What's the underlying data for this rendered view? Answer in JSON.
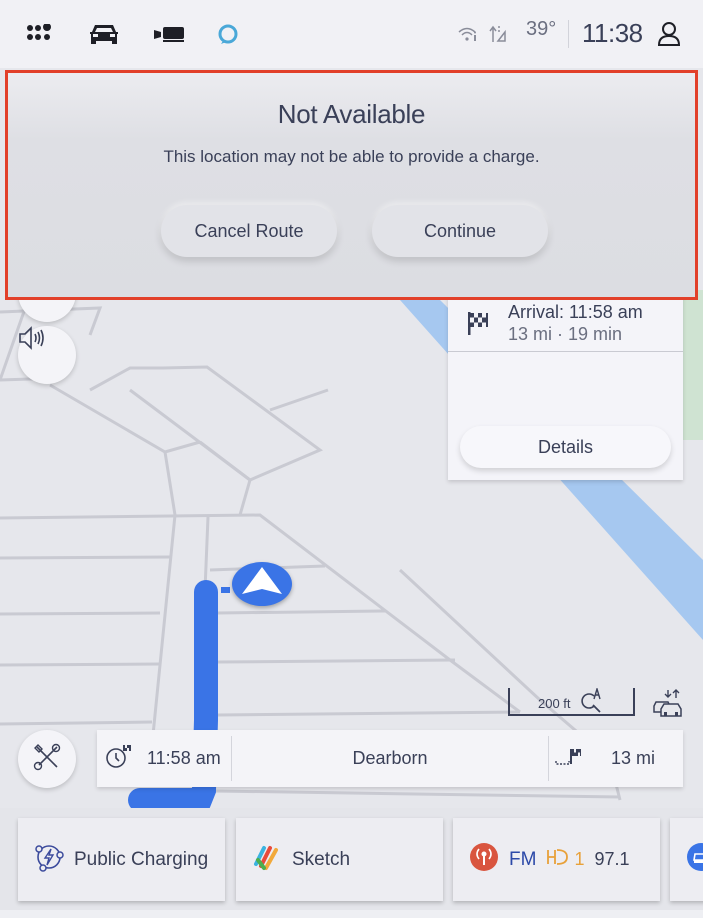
{
  "status_bar": {
    "icons": [
      "apps-grid-icon",
      "vehicle-icon",
      "camera-icon",
      "alexa-icon"
    ],
    "wifi_icon": "wifi-icon",
    "data_icon": "data-transfer-icon",
    "temperature": "39°",
    "time": "11:38",
    "profile_icon": "profile-icon"
  },
  "dialog": {
    "title": "Not Available",
    "message": "This location may not be able to provide a charge.",
    "buttons": {
      "cancel": "Cancel Route",
      "continue": "Continue"
    },
    "highlight_color": "#e2402a"
  },
  "map": {
    "controls": {
      "audio_icon": "speaker-icon",
      "tools_icon": "tools-icon"
    },
    "arrival_card": {
      "arrival": "Arrival: 11:58 am",
      "summary": "13 mi · 19 min",
      "details_label": "Details"
    },
    "scale_label": "200 ft",
    "route_color": "#3a74e6",
    "water_color": "#a6c8f0",
    "park_color": "#cfe3d2"
  },
  "trip_bar": {
    "eta": "11:58 am",
    "destination": "Dearborn",
    "distance": "13 mi"
  },
  "dock": {
    "tiles": [
      {
        "label": "Public Charging",
        "icon": "ev-charging-icon"
      },
      {
        "label": "Sketch",
        "icon": "sketch-app-icon"
      },
      {
        "band": "FM",
        "hd": "1",
        "frequency": "97.1",
        "icon": "radio-icon"
      },
      {
        "icon": "vehicle-app-icon"
      }
    ]
  }
}
